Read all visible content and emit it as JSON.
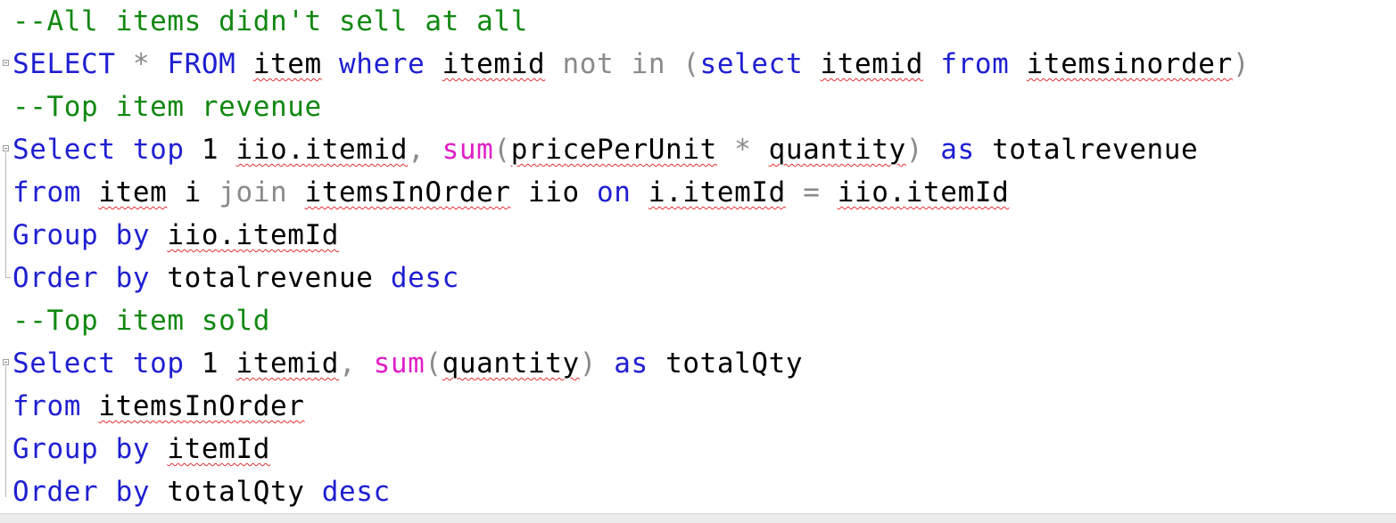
{
  "editor": {
    "lines": [
      {
        "tokens": [
          {
            "t": "--All items didn't sell at all",
            "c": "cm"
          }
        ]
      },
      {
        "tokens": [
          {
            "t": "SELECT",
            "c": "kw"
          },
          {
            "t": " ",
            "c": "tx"
          },
          {
            "t": "*",
            "c": "gr"
          },
          {
            "t": " ",
            "c": "tx"
          },
          {
            "t": "FROM",
            "c": "kw"
          },
          {
            "t": " ",
            "c": "tx"
          },
          {
            "t": "item",
            "c": "tx",
            "sq": true
          },
          {
            "t": " ",
            "c": "tx"
          },
          {
            "t": "where",
            "c": "kw"
          },
          {
            "t": " ",
            "c": "tx"
          },
          {
            "t": "itemid",
            "c": "tx",
            "sq": true
          },
          {
            "t": " ",
            "c": "tx"
          },
          {
            "t": "not",
            "c": "gr"
          },
          {
            "t": " ",
            "c": "tx"
          },
          {
            "t": "in",
            "c": "gr"
          },
          {
            "t": " ",
            "c": "tx"
          },
          {
            "t": "(",
            "c": "gr"
          },
          {
            "t": "select",
            "c": "kw"
          },
          {
            "t": " ",
            "c": "tx"
          },
          {
            "t": "itemid",
            "c": "tx",
            "sq": true
          },
          {
            "t": " ",
            "c": "tx"
          },
          {
            "t": "from",
            "c": "kw"
          },
          {
            "t": " ",
            "c": "tx"
          },
          {
            "t": "itemsinorder",
            "c": "tx",
            "sq": true
          },
          {
            "t": ")",
            "c": "gr"
          }
        ]
      },
      {
        "tokens": [
          {
            "t": "--Top item revenue",
            "c": "cm"
          }
        ]
      },
      {
        "tokens": [
          {
            "t": "Select",
            "c": "kw"
          },
          {
            "t": " ",
            "c": "tx"
          },
          {
            "t": "top",
            "c": "kw"
          },
          {
            "t": " 1 ",
            "c": "tx"
          },
          {
            "t": "iio.itemid",
            "c": "tx",
            "sq": true
          },
          {
            "t": ",",
            "c": "gr"
          },
          {
            "t": " ",
            "c": "tx"
          },
          {
            "t": "sum",
            "c": "fn"
          },
          {
            "t": "(",
            "c": "gr"
          },
          {
            "t": "pricePerUnit",
            "c": "tx",
            "sq": true
          },
          {
            "t": " ",
            "c": "tx"
          },
          {
            "t": "*",
            "c": "gr"
          },
          {
            "t": " ",
            "c": "tx"
          },
          {
            "t": "quantity",
            "c": "tx",
            "sq": true
          },
          {
            "t": ")",
            "c": "gr"
          },
          {
            "t": " ",
            "c": "tx"
          },
          {
            "t": "as",
            "c": "kw"
          },
          {
            "t": " totalrevenue",
            "c": "tx"
          }
        ]
      },
      {
        "tokens": [
          {
            "t": "from",
            "c": "kw"
          },
          {
            "t": " ",
            "c": "tx"
          },
          {
            "t": "item",
            "c": "tx",
            "sq": true
          },
          {
            "t": " i ",
            "c": "tx"
          },
          {
            "t": "join",
            "c": "gr"
          },
          {
            "t": " ",
            "c": "tx"
          },
          {
            "t": "itemsInOrder",
            "c": "tx",
            "sq": true
          },
          {
            "t": " iio ",
            "c": "tx"
          },
          {
            "t": "on",
            "c": "kw"
          },
          {
            "t": " ",
            "c": "tx"
          },
          {
            "t": "i.itemId",
            "c": "tx",
            "sq": true
          },
          {
            "t": " ",
            "c": "tx"
          },
          {
            "t": "=",
            "c": "gr"
          },
          {
            "t": " ",
            "c": "tx"
          },
          {
            "t": "iio.itemId",
            "c": "tx",
            "sq": true
          }
        ]
      },
      {
        "tokens": [
          {
            "t": "Group",
            "c": "kw"
          },
          {
            "t": " ",
            "c": "tx"
          },
          {
            "t": "by",
            "c": "kw"
          },
          {
            "t": " ",
            "c": "tx"
          },
          {
            "t": "iio.itemId",
            "c": "tx",
            "sq": true
          }
        ]
      },
      {
        "tokens": [
          {
            "t": "Order",
            "c": "kw"
          },
          {
            "t": " ",
            "c": "tx"
          },
          {
            "t": "by",
            "c": "kw"
          },
          {
            "t": " totalrevenue ",
            "c": "tx"
          },
          {
            "t": "desc",
            "c": "kw"
          }
        ]
      },
      {
        "tokens": [
          {
            "t": "--Top item sold",
            "c": "cm"
          }
        ]
      },
      {
        "tokens": [
          {
            "t": "Select",
            "c": "kw"
          },
          {
            "t": " ",
            "c": "tx"
          },
          {
            "t": "top",
            "c": "kw"
          },
          {
            "t": " 1 ",
            "c": "tx"
          },
          {
            "t": "itemid",
            "c": "tx",
            "sq": true
          },
          {
            "t": ",",
            "c": "gr"
          },
          {
            "t": " ",
            "c": "tx"
          },
          {
            "t": "sum",
            "c": "fn"
          },
          {
            "t": "(",
            "c": "gr"
          },
          {
            "t": "quantity",
            "c": "tx",
            "sq": true
          },
          {
            "t": ")",
            "c": "gr"
          },
          {
            "t": " ",
            "c": "tx"
          },
          {
            "t": "as",
            "c": "kw"
          },
          {
            "t": " totalQty",
            "c": "tx"
          }
        ]
      },
      {
        "tokens": [
          {
            "t": "from",
            "c": "kw"
          },
          {
            "t": " ",
            "c": "tx"
          },
          {
            "t": "itemsInOrder",
            "c": "tx",
            "sq": true
          }
        ]
      },
      {
        "tokens": [
          {
            "t": "Group",
            "c": "kw"
          },
          {
            "t": " ",
            "c": "tx"
          },
          {
            "t": "by",
            "c": "kw"
          },
          {
            "t": " ",
            "c": "tx"
          },
          {
            "t": "itemId",
            "c": "tx",
            "sq": true
          }
        ]
      },
      {
        "tokens": [
          {
            "t": "Order",
            "c": "kw"
          },
          {
            "t": " ",
            "c": "tx"
          },
          {
            "t": "by",
            "c": "kw"
          },
          {
            "t": " totalQty ",
            "c": "tx"
          },
          {
            "t": "desc",
            "c": "kw"
          }
        ]
      }
    ]
  },
  "colors": {
    "keyword": "#1f1fd2",
    "comment": "#118811",
    "operator": "#8a8a8a",
    "function": "#e020c8",
    "identifier": "#000000",
    "squiggle": "#e23030"
  },
  "icons": {
    "fold": "fold-collapse-icon"
  }
}
